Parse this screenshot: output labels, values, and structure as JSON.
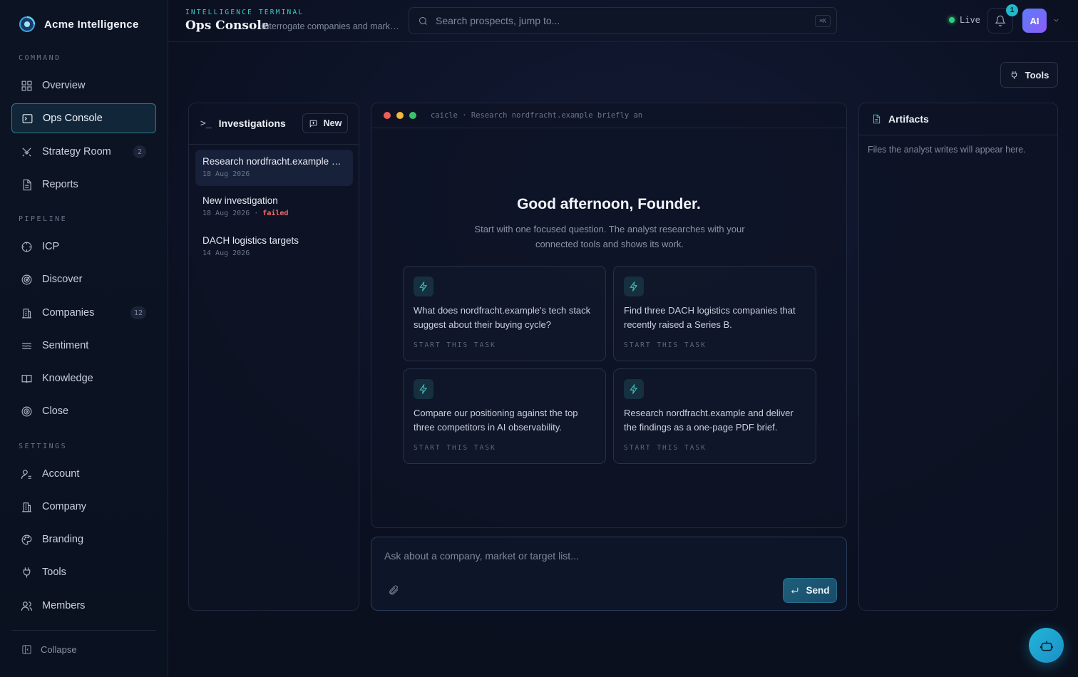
{
  "brand": {
    "name": "Acme Intelligence"
  },
  "sidebar": {
    "sections": [
      "COMMAND",
      "PIPELINE",
      "SETTINGS"
    ],
    "command": [
      {
        "label": "Overview",
        "icon": "grid-icon"
      },
      {
        "label": "Ops Console",
        "icon": "terminal-icon",
        "active": true
      },
      {
        "label": "Strategy Room",
        "icon": "swords-icon",
        "badge": "2"
      },
      {
        "label": "Reports",
        "icon": "document-icon"
      }
    ],
    "pipeline": [
      {
        "label": "ICP",
        "icon": "crosshair-icon"
      },
      {
        "label": "Discover",
        "icon": "radar-icon"
      },
      {
        "label": "Companies",
        "icon": "building-icon",
        "badge": "12"
      },
      {
        "label": "Sentiment",
        "icon": "waves-icon"
      },
      {
        "label": "Knowledge",
        "icon": "book-icon"
      },
      {
        "label": "Close",
        "icon": "target-icon"
      }
    ],
    "settings": [
      {
        "label": "Account",
        "icon": "user-icon"
      },
      {
        "label": "Company",
        "icon": "building-icon"
      },
      {
        "label": "Branding",
        "icon": "palette-icon"
      },
      {
        "label": "Tools",
        "icon": "plug-icon"
      },
      {
        "label": "Members",
        "icon": "users-icon"
      }
    ],
    "collapse_label": "Collapse"
  },
  "header": {
    "eyebrow": "INTELLIGENCE TERMINAL",
    "title": "Ops Console",
    "subtitle": "Interrogate companies and markets",
    "search_placeholder": "Search prospects, jump to...",
    "shortcut": "⌘K",
    "live_label": "Live",
    "notification_count": "1",
    "avatar_initials": "AI"
  },
  "tools_button": "Tools",
  "investigations": {
    "title": "Investigations",
    "prompt": ">_",
    "new_label": "New",
    "items": [
      {
        "title": "Research nordfracht.example briefly and summarize",
        "date": "18 Aug 2026",
        "status": "",
        "active": true
      },
      {
        "title": "New investigation",
        "date": "18 Aug 2026",
        "status": "failed"
      },
      {
        "title": "DACH logistics targets",
        "date": "14 Aug 2026",
        "status": ""
      }
    ]
  },
  "terminal": {
    "header_text": "caicle · Research nordfracht.example briefly an",
    "greeting": "Good afternoon, Founder.",
    "greeting_sub": "Start with one focused question. The analyst researches with your connected tools and shows its work.",
    "cta": "START THIS TASK",
    "tasks": [
      "What does nordfracht.example's tech stack suggest about their buying cycle?",
      "Find three DACH logistics companies that recently raised a Series B.",
      "Compare our positioning against the top three competitors in AI observability.",
      "Research nordfracht.example and deliver the findings as a one-page PDF brief."
    ]
  },
  "composer": {
    "placeholder": "Ask about a company, market or target list...",
    "send_label": "Send"
  },
  "artifacts": {
    "title": "Artifacts",
    "empty": "Files the analyst writes will appear here."
  },
  "colors": {
    "accent": "#3fc9c3",
    "live": "#2ecf7a",
    "failed": "#f26b6b",
    "avatar": "#6d6cf7"
  }
}
